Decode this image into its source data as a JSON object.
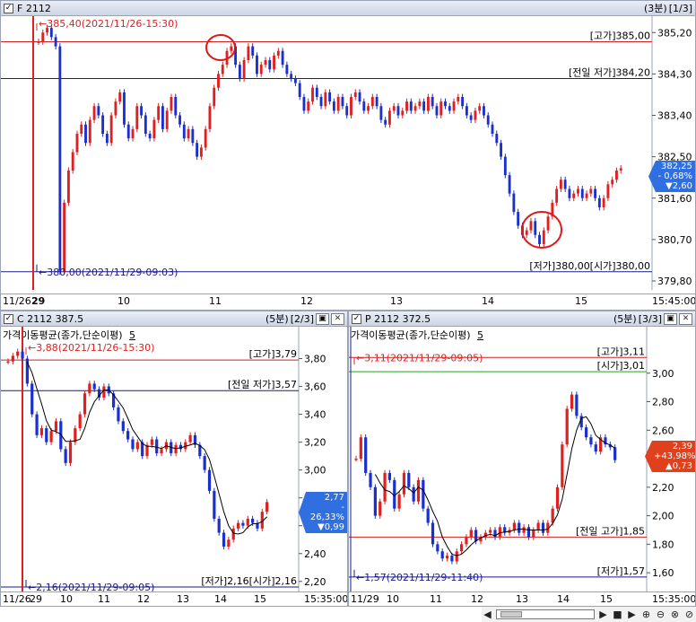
{
  "colors": {
    "up": "#e02020",
    "down": "#1a2fd0",
    "ref_red": "#d02020",
    "ref_navy": "#1a1a8a",
    "ref_green": "#2aa02a",
    "circle": "#e01818",
    "ma": "#000000"
  },
  "panels": [
    {
      "id": "F",
      "check": "✓",
      "title": "F 2112",
      "period": "(3분)",
      "page": "[1/3]",
      "ma_label": "",
      "ma_period": "",
      "yticks": [
        "385,20",
        "384,30",
        "383,40",
        "382,50",
        "381,60",
        "380,70",
        "379,80"
      ],
      "ref_labels": [
        "[고가]385,00",
        "[전일 저가]384,20",
        "[저가]380,00[시가]380,00"
      ],
      "max_annot": "385,40(2021/11/26-15:30)",
      "min_annot": "380,00(2021/11/29-09:03)",
      "side": {
        "price": "382,25",
        "pct": "- 0,68%",
        "chg": "▼2,60",
        "color": "blue"
      },
      "xlabels": [
        "11/26",
        "29",
        "10",
        "11",
        "12",
        "13",
        "14",
        "15",
        "15:45:00"
      ],
      "chart_data": {
        "type": "candlestick",
        "ylim": [
          379.8,
          385.4
        ],
        "references": {
          "high": 385.0,
          "prev_low": 384.2,
          "low": 380.0,
          "open": 380.0
        },
        "max_point": 385.4,
        "min_point": 380.0,
        "closes": [
          385.0,
          385.2,
          385.3,
          385.1,
          384.9,
          380.0,
          381.5,
          382.2,
          382.6,
          383.0,
          383.2,
          382.8,
          383.3,
          383.6,
          383.4,
          383.0,
          382.8,
          383.4,
          383.7,
          383.9,
          383.2,
          382.9,
          383.1,
          383.6,
          383.4,
          383.0,
          382.9,
          383.3,
          383.6,
          383.1,
          383.5,
          383.8,
          383.4,
          383.2,
          382.9,
          383.1,
          382.8,
          382.5,
          382.7,
          383.1,
          383.6,
          384.0,
          384.3,
          384.5,
          384.8,
          384.9,
          384.5,
          384.2,
          384.6,
          384.9,
          384.7,
          384.3,
          384.5,
          384.6,
          384.4,
          384.7,
          384.8,
          384.5,
          384.3,
          384.2,
          384.1,
          383.8,
          383.5,
          383.7,
          384.0,
          383.8,
          383.6,
          383.9,
          383.7,
          383.5,
          383.8,
          383.6,
          383.4,
          383.8,
          383.9,
          383.7,
          383.5,
          383.6,
          383.8,
          383.6,
          383.3,
          383.2,
          383.5,
          383.6,
          383.4,
          383.5,
          383.7,
          383.5,
          383.6,
          383.7,
          383.5,
          383.8,
          383.6,
          383.4,
          383.7,
          383.6,
          383.5,
          383.7,
          383.8,
          383.6,
          383.4,
          383.3,
          383.5,
          383.6,
          383.4,
          383.2,
          383.0,
          382.8,
          382.5,
          382.1,
          381.7,
          381.3,
          381.0,
          380.8,
          380.9,
          381.1,
          380.8,
          380.6,
          380.9,
          381.2,
          381.5,
          381.8,
          382.0,
          381.8,
          381.6,
          381.7,
          381.8,
          381.6,
          381.7,
          381.8,
          381.6,
          381.4,
          381.6,
          381.9,
          382.0,
          382.2,
          382.25
        ]
      }
    },
    {
      "id": "C",
      "check": "✓",
      "title": "C 2112 387.5",
      "period": "(5분)",
      "page": "[2/3]",
      "ma_label": "가격이동평균(종가,단순이평)",
      "ma_period": "5",
      "yticks": [
        "3,80",
        "3,60",
        "3,40",
        "3,20",
        "3,00",
        "2,80",
        "2,60",
        "2,40",
        "2,20"
      ],
      "ref_labels": [
        "[고가]3,79",
        "[전일 저가]3,57",
        "[저가]2,16[시가]2,16"
      ],
      "max_annot": "3,88(2021/11/26-15:30)",
      "min_annot": "2,16(2021/11/29-09:05)",
      "side": {
        "price": "2,77",
        "pct": "- 26,33%",
        "chg": "▼0,99",
        "color": "blue"
      },
      "xlabels": [
        "11/26",
        "29",
        "10",
        "11",
        "12",
        "13",
        "14",
        "15",
        "15:35:00"
      ],
      "chart_data": {
        "type": "candlestick",
        "ylim": [
          2.16,
          3.9
        ],
        "references": {
          "high": 3.79,
          "prev_low": 3.57,
          "low": 2.16,
          "open": 2.16
        },
        "max_point": 3.88,
        "min_point": 2.16,
        "closes": [
          3.78,
          3.82,
          3.85,
          3.8,
          3.62,
          3.4,
          3.25,
          3.3,
          3.2,
          3.28,
          3.35,
          3.15,
          3.05,
          3.2,
          3.3,
          3.4,
          3.55,
          3.62,
          3.58,
          3.52,
          3.6,
          3.55,
          3.45,
          3.35,
          3.28,
          3.22,
          3.15,
          3.2,
          3.1,
          3.18,
          3.22,
          3.12,
          3.15,
          3.2,
          3.12,
          3.18,
          3.15,
          3.2,
          3.25,
          3.18,
          3.1,
          3.0,
          2.85,
          2.65,
          2.55,
          2.45,
          2.5,
          2.58,
          2.62,
          2.6,
          2.65,
          2.62,
          2.58,
          2.7,
          2.77
        ]
      }
    },
    {
      "id": "P",
      "check": "✓",
      "title": "P 2112 372.5",
      "period": "(5분)",
      "page": "[3/3]",
      "ma_label": "가격이동평균(종가,단순이평)",
      "ma_period": "5",
      "yticks": [
        "3,00",
        "2,80",
        "2,60",
        "2,40",
        "2,20",
        "2,00",
        "1,80",
        "1,60"
      ],
      "ref_labels": [
        "[고가]3,11",
        "[시가]3,01",
        "[전일 고가]1,85",
        "[저가]1,57"
      ],
      "max_annot": "3,11(2021/11/29-09:05)",
      "min_annot": "1,57(2021/11/29-11:40)",
      "side": {
        "price": "2,39",
        "pct": "+43,98%",
        "chg": "▲0,73",
        "color": "red"
      },
      "xlabels": [
        "11/29",
        "10",
        "11",
        "12",
        "13",
        "14",
        "15",
        "15:35:00"
      ],
      "chart_data": {
        "type": "candlestick",
        "ylim": [
          1.5,
          3.2
        ],
        "references": {
          "high": 3.11,
          "open": 3.01,
          "prev_high": 1.85,
          "low": 1.57
        },
        "max_point": 3.11,
        "min_point": 1.57,
        "closes": [
          2.4,
          2.55,
          2.3,
          2.2,
          2.0,
          2.1,
          2.3,
          2.25,
          2.05,
          2.15,
          2.3,
          2.2,
          2.1,
          2.25,
          2.05,
          1.95,
          1.8,
          1.75,
          1.7,
          1.72,
          1.68,
          1.75,
          1.8,
          1.85,
          1.9,
          1.82,
          1.85,
          1.88,
          1.9,
          1.85,
          1.92,
          1.88,
          1.9,
          1.95,
          1.88,
          1.92,
          1.85,
          1.9,
          1.95,
          1.88,
          1.95,
          2.05,
          2.2,
          2.5,
          2.75,
          2.85,
          2.7,
          2.62,
          2.55,
          2.5,
          2.45,
          2.55,
          2.5,
          2.48,
          2.39
        ]
      }
    }
  ]
}
